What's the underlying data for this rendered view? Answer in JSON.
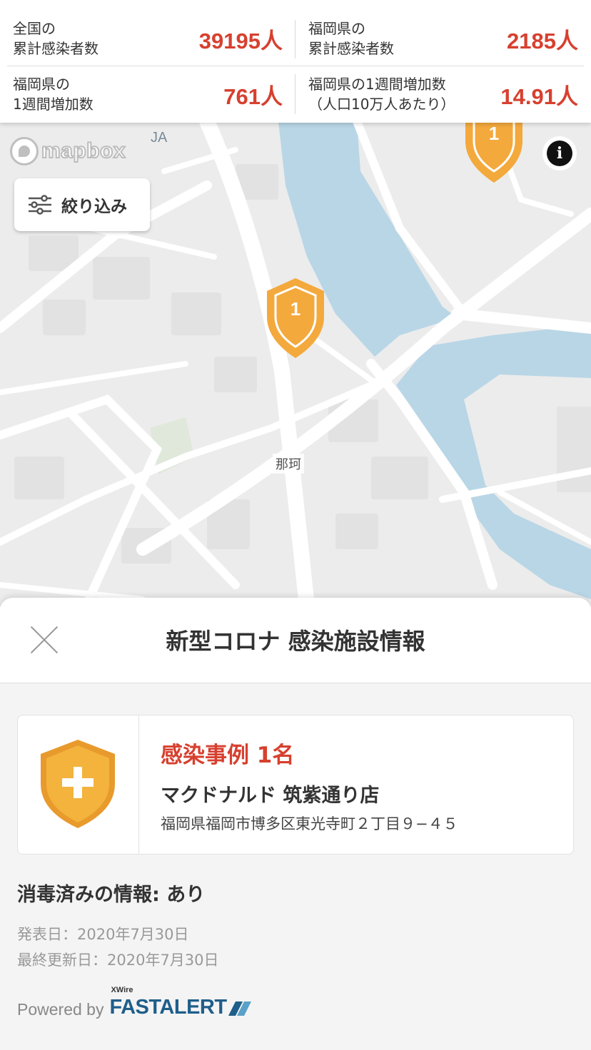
{
  "stats": {
    "national_cumulative": {
      "label": "全国の\n累計感染者数",
      "value": "39195人"
    },
    "pref_cumulative": {
      "label": "福岡県の\n累計感染者数",
      "value": "2185人"
    },
    "pref_weekly": {
      "label": "福岡県の\n1週間増加数",
      "value": "761人"
    },
    "pref_weekly_per100k": {
      "label": "福岡県の1週間増加数\n（人口10万人あたり）",
      "value": "14.91人"
    }
  },
  "map": {
    "attribution_logo": "mapbox",
    "info_label": "i",
    "filter_label": "絞り込み",
    "labels": {
      "ja": "JA",
      "district": "那珂"
    },
    "pins": [
      {
        "count": "1",
        "color": "#f3a93c"
      },
      {
        "count": "1",
        "color": "#f3a93c"
      }
    ],
    "colors": {
      "land": "#ececec",
      "road": "#ffffff",
      "water": "#b8d6e6",
      "park": "#dfe8da",
      "building": "#e2e2e2"
    }
  },
  "sheet": {
    "title": "新型コロナ 感染施設情報",
    "case_count": "感染事例 1名",
    "place_name": "マクドナルド 筑紫通り店",
    "address": "福岡県福岡市博多区東光寺町２丁目９−４５",
    "disinfection": "消毒済みの情報: あり",
    "published": "発表日：2020年7月30日",
    "updated": "最終更新日：2020年7月30日",
    "powered_by": "Powered by",
    "brand": "FASTALERT",
    "brand_sub": "XWire",
    "colors": {
      "accent": "#d7402f",
      "shield": "#f3b33d",
      "brand": "#1f5e8a"
    }
  }
}
